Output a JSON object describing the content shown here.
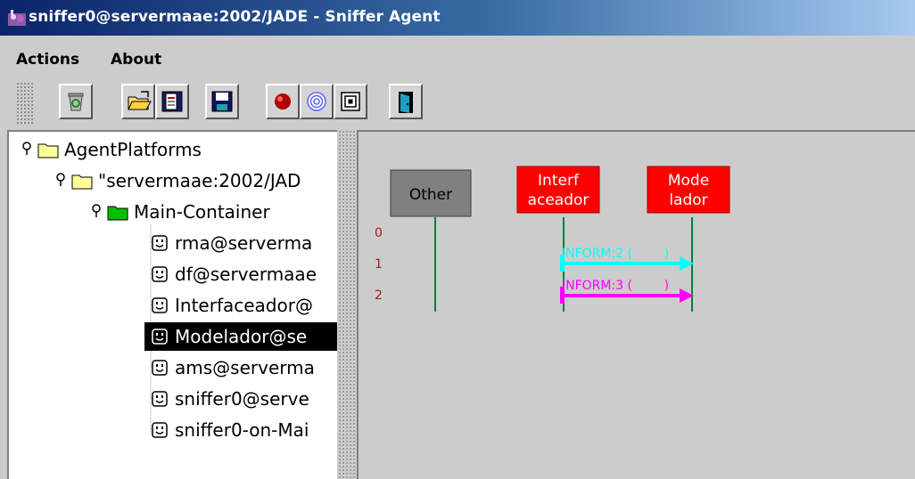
{
  "window": {
    "title": "sniffer0@servermaae:2002/JADE - Sniffer Agent",
    "icon": "jade-sniffer-icon"
  },
  "menu": {
    "items": [
      "Actions",
      "About"
    ]
  },
  "toolbar": {
    "buttons": [
      {
        "name": "clear-canvas-button",
        "icon": "recycle-bin-icon"
      },
      {
        "name": "open-button",
        "icon": "folder-open-icon"
      },
      {
        "name": "write-messages-button",
        "icon": "document-icon"
      },
      {
        "name": "save-button",
        "icon": "floppy-disk-icon"
      },
      {
        "name": "sniff-on-button",
        "icon": "red-record-icon"
      },
      {
        "name": "sniff-off-button",
        "icon": "spiral-icon"
      },
      {
        "name": "show-only-button",
        "icon": "nested-squares-icon"
      },
      {
        "name": "exit-button",
        "icon": "door-exit-icon"
      }
    ]
  },
  "tree": {
    "root": "AgentPlatforms",
    "platform": "\"servermaae:2002/JAD",
    "container": "Main-Container",
    "agents": [
      "rma@serverma",
      "df@servermaae",
      "Interfaceador@",
      "Modelador@se",
      "ams@serverma",
      "sniffer0@serve",
      "sniffer0-on-Mai"
    ],
    "selected_index": 3
  },
  "canvas": {
    "agents": [
      {
        "label": [
          "Other"
        ],
        "color": "#808080",
        "text_color": "#000000"
      },
      {
        "label": [
          "Interf",
          "aceador"
        ],
        "color": "#ff0000",
        "text_color": "#ffffff"
      },
      {
        "label": [
          "Mode",
          "lador"
        ],
        "color": "#ff0000",
        "text_color": "#ffffff"
      }
    ],
    "row_numbers": [
      "0",
      "1",
      "2"
    ],
    "messages": [
      {
        "label": "INFORM:2 (        )",
        "color": "#00ffff"
      },
      {
        "label": "INFORM:3 (        )",
        "color": "#ff00ff"
      }
    ]
  }
}
